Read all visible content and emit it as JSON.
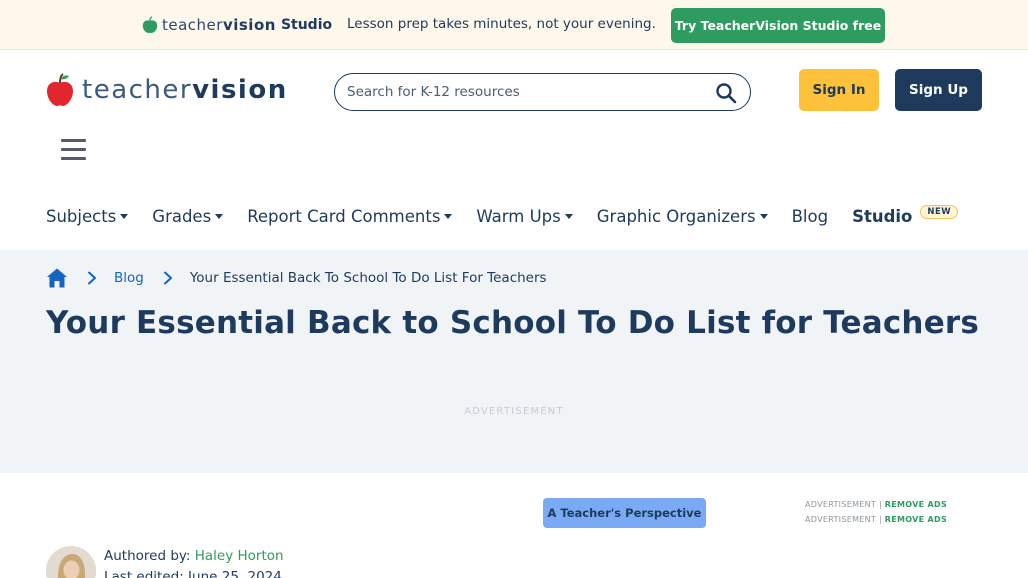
{
  "promo": {
    "logo_light": "teacher",
    "logo_bold": "vision",
    "logo_studio": "Studio",
    "message": "Lesson prep takes minutes, not your evening.",
    "cta_label": "Try TeacherVision Studio free"
  },
  "header": {
    "logo_light": "teacher",
    "logo_bold": "vision",
    "search_placeholder": "Search for K-12 resources",
    "sign_in_label": "Sign In",
    "sign_up_label": "Sign Up"
  },
  "nav": {
    "items": [
      {
        "label": "Subjects"
      },
      {
        "label": "Grades"
      },
      {
        "label": "Report Card Comments"
      },
      {
        "label": "Warm Ups"
      },
      {
        "label": "Graphic Organizers"
      },
      {
        "label": "Blog"
      },
      {
        "label": "Studio",
        "badge": "NEW"
      }
    ]
  },
  "breadcrumb": {
    "blog_label": "Blog",
    "current": "Your Essential Back To School To Do List For Teachers"
  },
  "page": {
    "title": "Your Essential Back to School To Do List for Teachers",
    "ad_label": "ADVERTISEMENT"
  },
  "article": {
    "tag": "A Teacher's Perspective",
    "side_ad_label": "ADVERTISEMENT |",
    "remove_ads_label": "REMOVE ADS",
    "authored_by_label": "Authored by:",
    "author_name": "Haley Horton",
    "last_edited": "Last edited: June 25, 2024"
  },
  "colors": {
    "navy": "#1e3a5c",
    "green": "#2e9b61",
    "yellow": "#fdc13a",
    "apple_red": "#e3262d",
    "link_blue": "#1565c0",
    "promo_bg": "#fdf7ec",
    "band_bg": "#f1f4f7"
  },
  "icons": {
    "search": "search-icon",
    "home": "home-icon",
    "chevron": "chevron-right-icon",
    "menu": "hamburger-menu-icon",
    "apple": "apple-logo-icon"
  }
}
